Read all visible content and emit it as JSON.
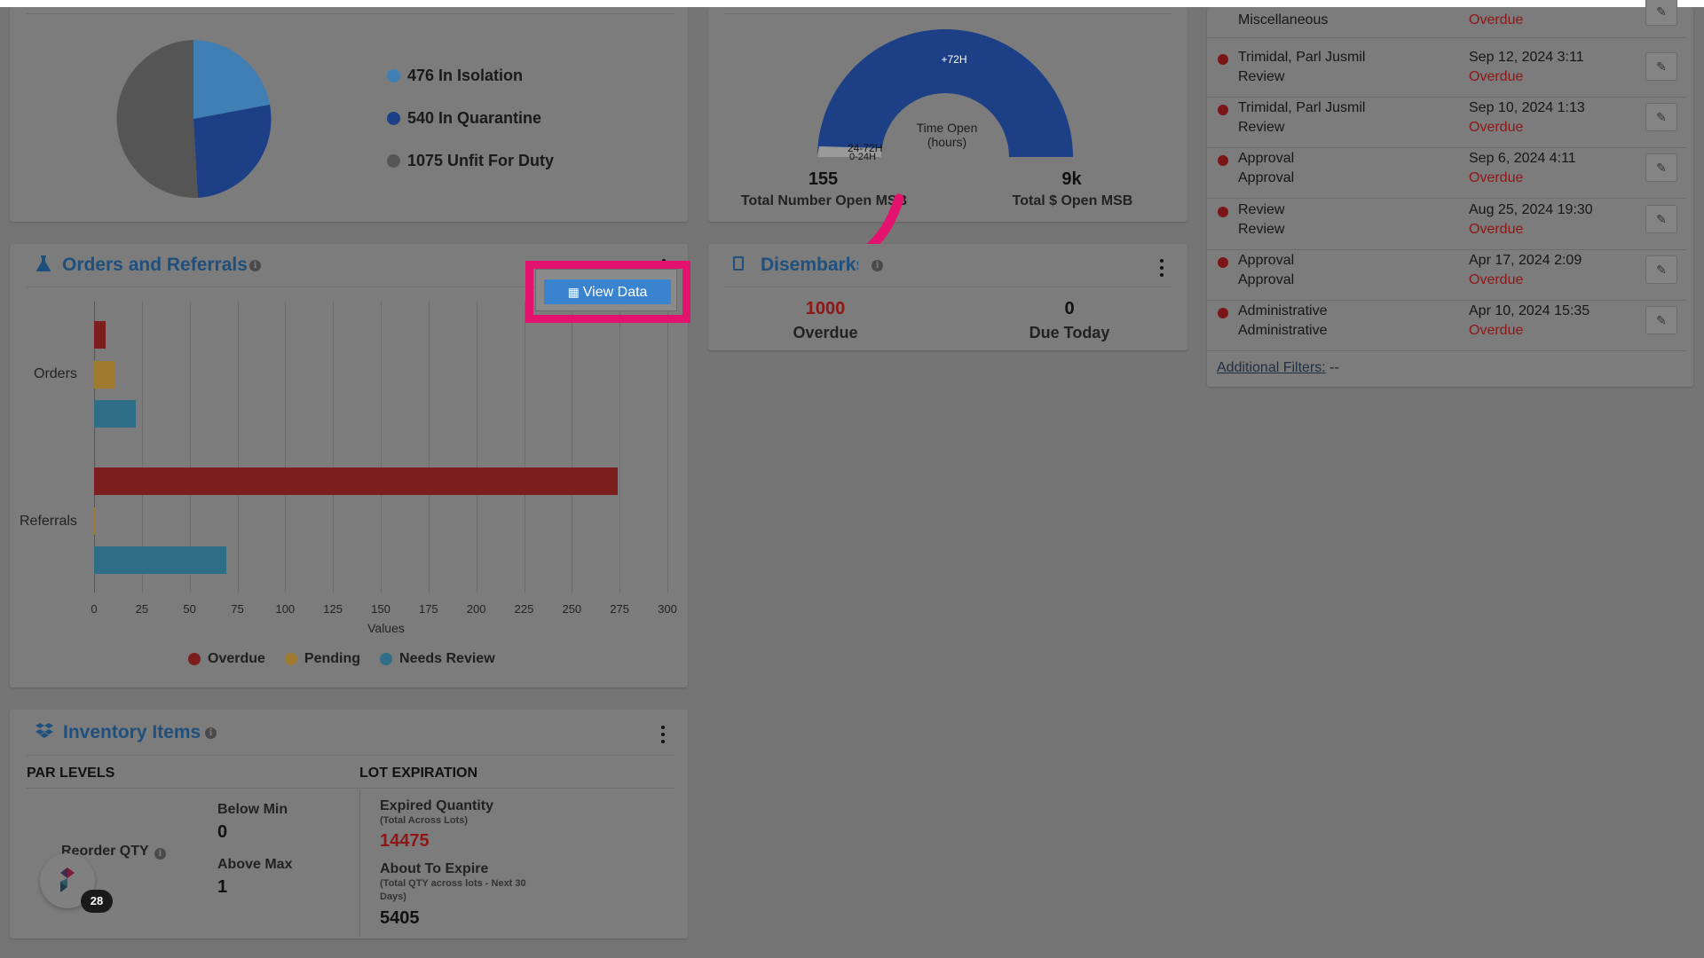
{
  "isolation_card": {
    "legend": [
      {
        "label": "476 In Isolation",
        "color": "#3f7fb4"
      },
      {
        "label": "540 In Quarantine",
        "color": "#1c3f86"
      },
      {
        "label": "1075 Unfit For Duty",
        "color": "#555555"
      }
    ]
  },
  "msb_card": {
    "gauge_center": "Time Open\n(hours)",
    "gauge_labels": {
      "top": "+72H",
      "left_1": "24-72H",
      "left_2": "0-24H"
    },
    "total_open_value": "155",
    "total_open_label": "Total Number Open MSB",
    "total_dollar_value": "9k",
    "total_dollar_label": "Total $ Open MSB"
  },
  "orders_card": {
    "title": "Orders and Referrals",
    "view_data_label": "View Data"
  },
  "chart_data": {
    "type": "bar",
    "orientation": "horizontal",
    "categories": [
      "Orders",
      "Referrals"
    ],
    "series": [
      {
        "name": "Overdue",
        "color": "#7d1e1e",
        "values": [
          6,
          274
        ]
      },
      {
        "name": "Pending",
        "color": "#a07a2f",
        "values": [
          11,
          1
        ]
      },
      {
        "name": "Needs Review",
        "color": "#2f6e87",
        "values": [
          22,
          69
        ]
      }
    ],
    "xlabel": "Values",
    "xlim": [
      0,
      300
    ],
    "xticks": [
      "0",
      "25",
      "50",
      "75",
      "100",
      "125",
      "150",
      "175",
      "200",
      "225",
      "250",
      "275",
      "300"
    ],
    "grid": true,
    "legend_position": "bottom"
  },
  "disembarks_card": {
    "title": "Disembarks",
    "overdue_value": "1000",
    "overdue_label": "Overdue",
    "due_today_value": "0",
    "due_today_label": "Due Today"
  },
  "task_list": {
    "rows": [
      {
        "name1": "",
        "name2": "Miscellaneous",
        "date": "",
        "status": "Overdue"
      },
      {
        "name1": "Trimidal, Parl Jusmil",
        "name2": "Review",
        "date": "Sep 12, 2024 3:11",
        "status": "Overdue"
      },
      {
        "name1": "Trimidal, Parl Jusmil",
        "name2": "Review",
        "date": "Sep 10, 2024 1:13",
        "status": "Overdue"
      },
      {
        "name1": "Approval",
        "name2": "Approval",
        "date": "Sep 6, 2024 4:11",
        "status": "Overdue"
      },
      {
        "name1": "Review",
        "name2": "Review",
        "date": "Aug 25, 2024 19:30",
        "status": "Overdue"
      },
      {
        "name1": "Approval",
        "name2": "Approval",
        "date": "Apr 17, 2024 2:09",
        "status": "Overdue"
      },
      {
        "name1": "Administrative",
        "name2": "Administrative",
        "date": "Apr 10, 2024 15:35",
        "status": "Overdue"
      }
    ],
    "additional_filters_label": "Additional Filters:",
    "additional_filters_value": "--"
  },
  "inventory_card": {
    "title": "Inventory Items",
    "par_levels_header": "PAR LEVELS",
    "lot_expiration_header": "LOT EXPIRATION",
    "reorder_label": "Reorder QTY",
    "below_min_label": "Below Min",
    "below_min_value": "0",
    "above_max_label": "Above Max",
    "above_max_value": "1",
    "expired_label": "Expired Quantity",
    "expired_sub": "(Total Across Lots)",
    "expired_value": "14475",
    "about_label": "About To Expire",
    "about_sub": "(Total QTY across lots - Next 30 Days)",
    "about_value": "5405",
    "badge_count": "28"
  }
}
